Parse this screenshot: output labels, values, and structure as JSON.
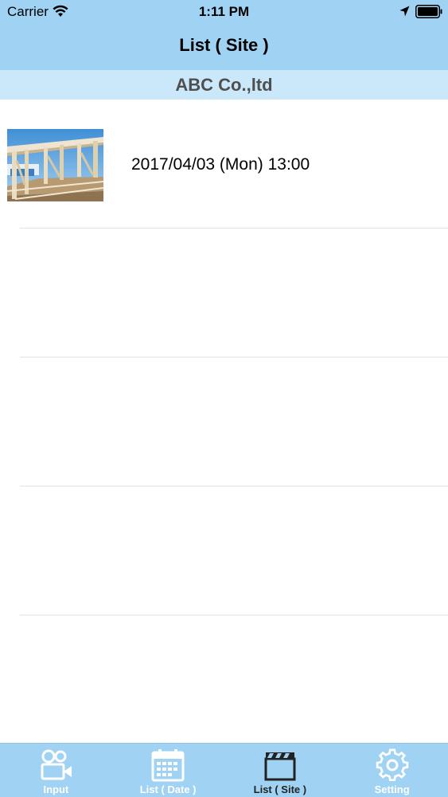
{
  "status_bar": {
    "carrier": "Carrier",
    "time": "1:11 PM",
    "icons": [
      "wifi-icon",
      "location-icon",
      "battery-icon"
    ]
  },
  "nav": {
    "title": "List ( Site )"
  },
  "section": {
    "header": "ABC Co.,ltd"
  },
  "list": {
    "items": [
      {
        "date": "2017/04/03 (Mon) 13:00",
        "thumbnail": "construction-site-photo"
      }
    ]
  },
  "tab_bar": {
    "tabs": [
      {
        "label": "Input",
        "icon": "video-camera-icon",
        "active": false
      },
      {
        "label": "List ( Date )",
        "icon": "calendar-icon",
        "active": false
      },
      {
        "label": "List ( Site )",
        "icon": "clapperboard-icon",
        "active": true
      },
      {
        "label": "Setting",
        "icon": "gear-icon",
        "active": false
      }
    ]
  },
  "colors": {
    "bar_background": "#9fd2f3",
    "section_background": "#cbe8fb",
    "active_tab": "#222222",
    "inactive_tab": "#ffffff"
  }
}
